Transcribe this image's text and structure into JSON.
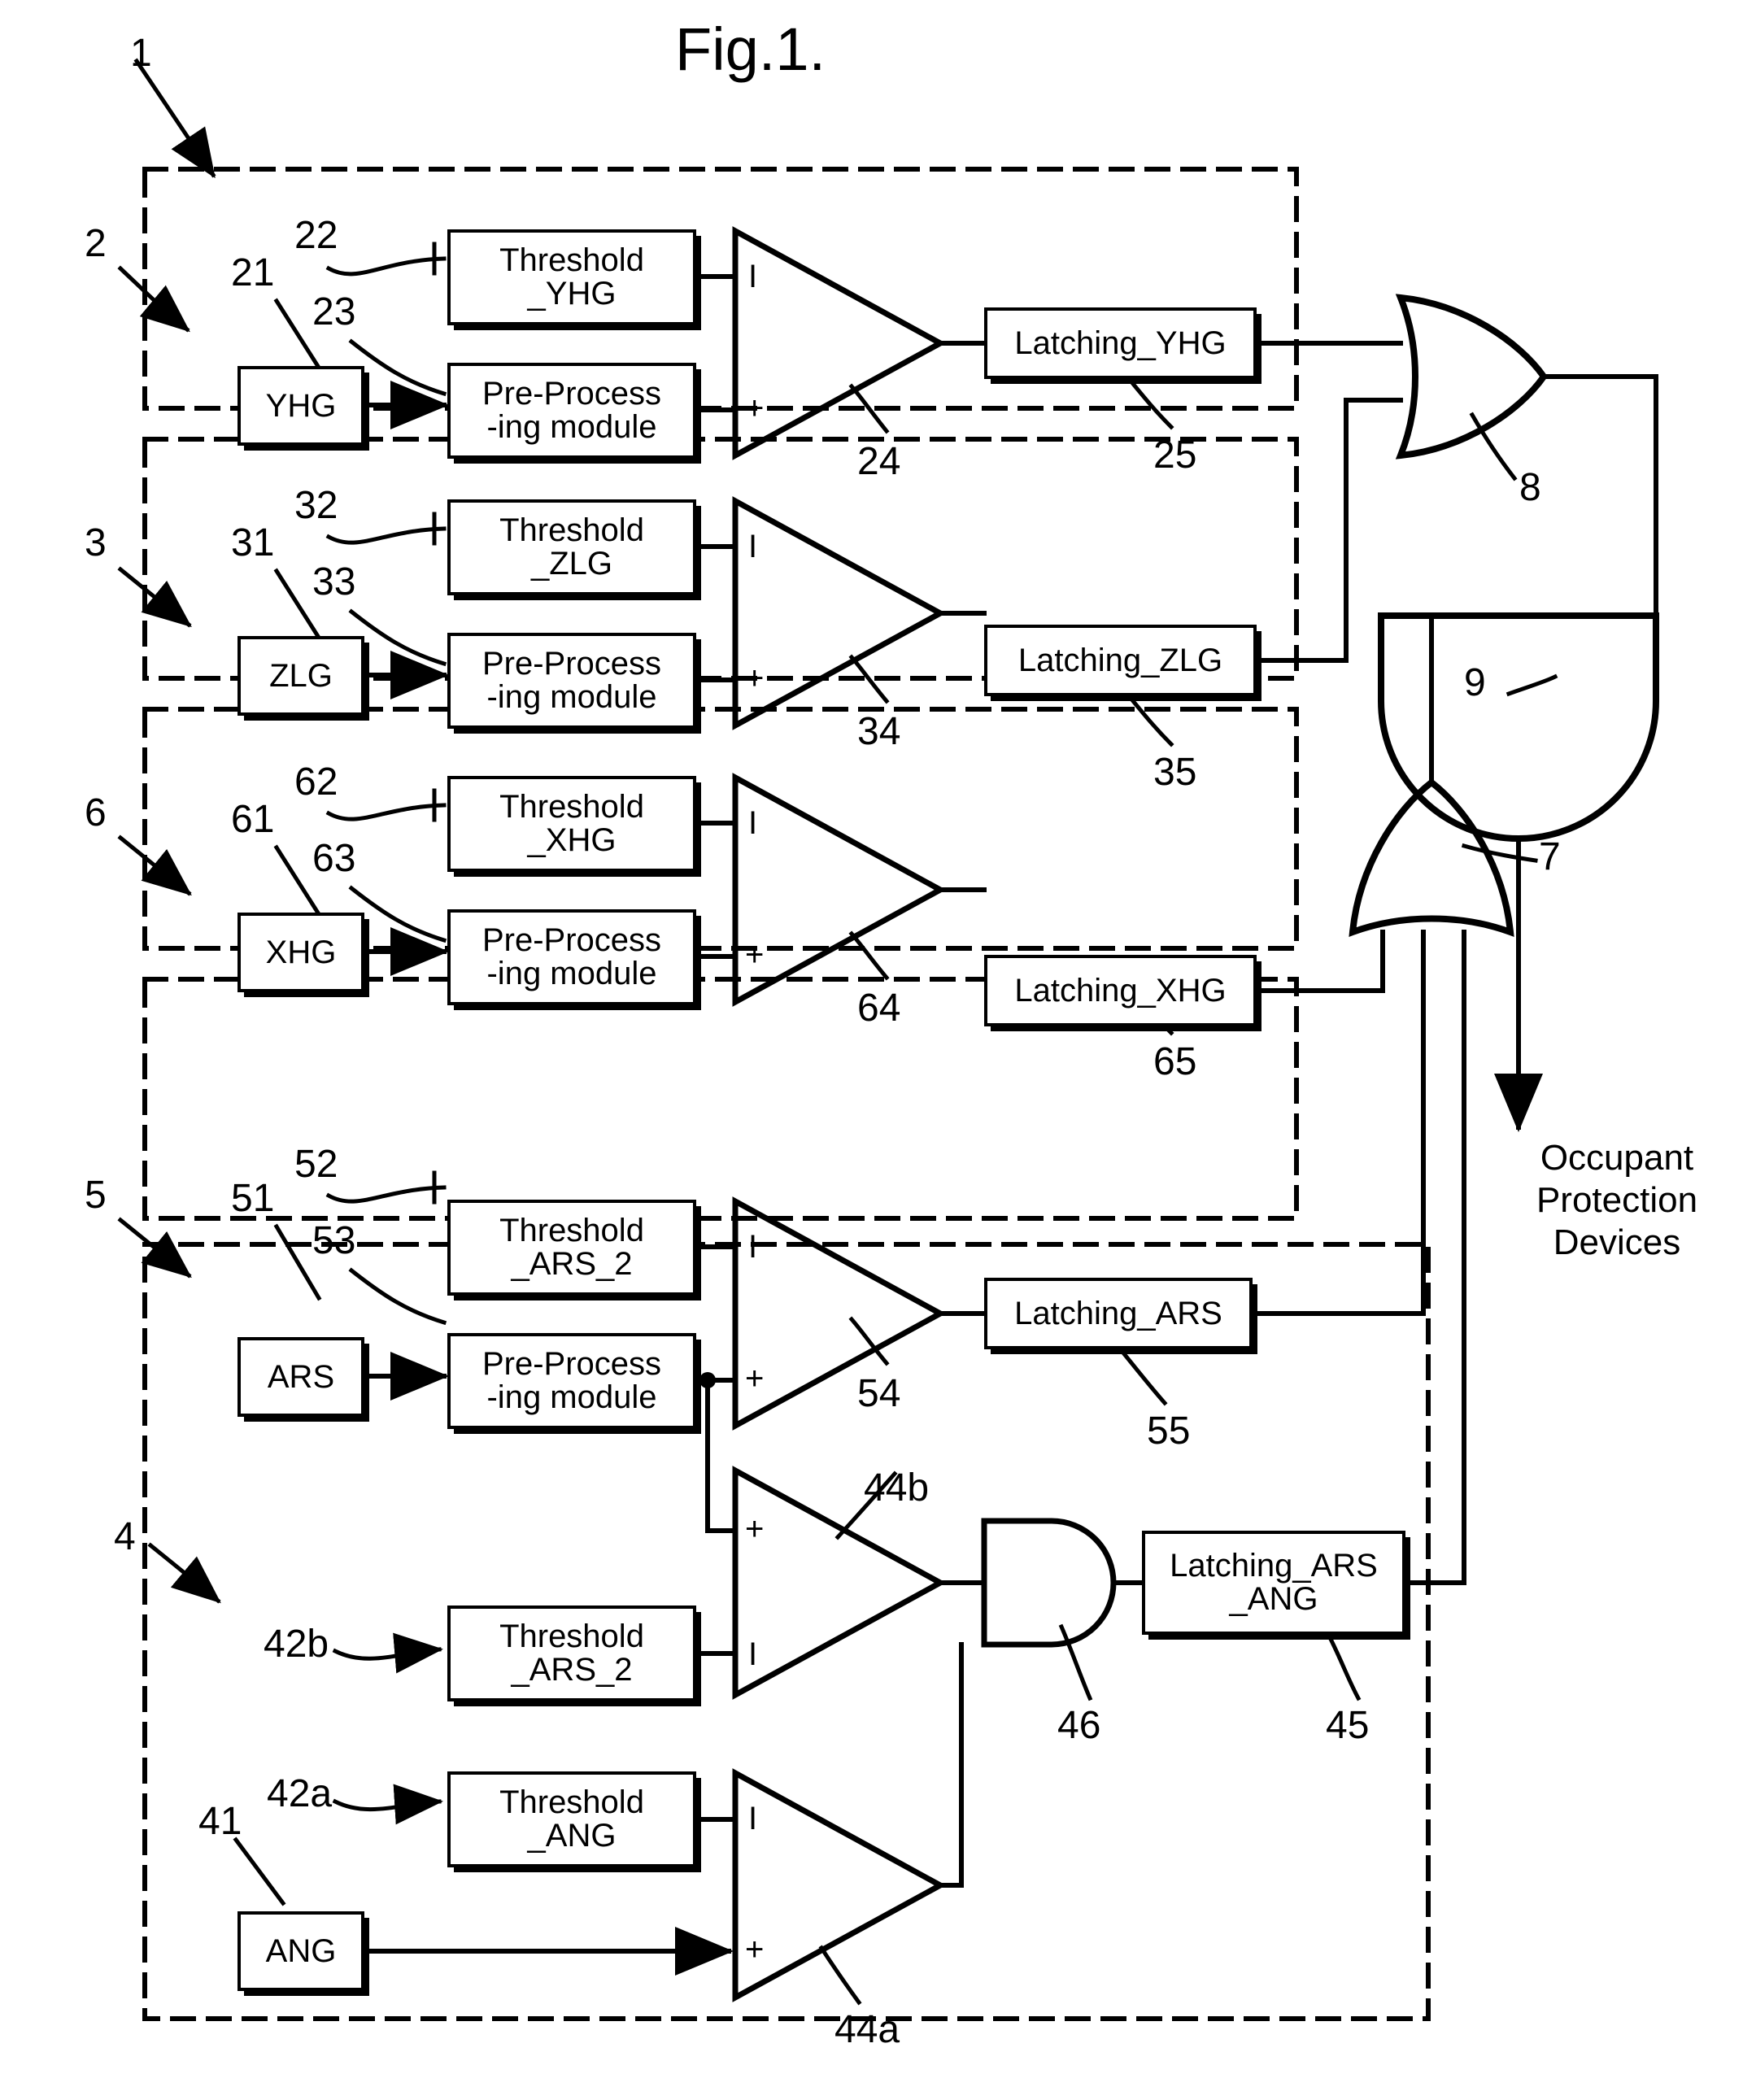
{
  "figure": {
    "title": "Fig.1."
  },
  "output_label": {
    "line1": "Occupant",
    "line2": "Protection",
    "line3": "Devices"
  },
  "channels": [
    {
      "id": "yhg",
      "group_ref": "2",
      "sensor": {
        "ref": "21",
        "label": "YHG"
      },
      "threshold": {
        "ref": "22",
        "line1": "Threshold",
        "line2": "_YHG"
      },
      "preproc": {
        "ref": "23",
        "line1": "Pre-Process",
        "line2": "-ing module"
      },
      "comparator": {
        "ref": "24",
        "minus": "I",
        "plus": "+"
      },
      "latching": {
        "ref": "25",
        "label": "Latching_YHG"
      }
    },
    {
      "id": "zlg",
      "group_ref": "3",
      "sensor": {
        "ref": "31",
        "label": "ZLG"
      },
      "threshold": {
        "ref": "32",
        "line1": "Threshold",
        "line2": "_ZLG"
      },
      "preproc": {
        "ref": "33",
        "line1": "Pre-Process",
        "line2": "-ing module"
      },
      "comparator": {
        "ref": "34",
        "minus": "I",
        "plus": "+"
      },
      "latching": {
        "ref": "35",
        "label": "Latching_ZLG"
      }
    },
    {
      "id": "xhg",
      "group_ref": "6",
      "sensor": {
        "ref": "61",
        "label": "XHG"
      },
      "threshold": {
        "ref": "62",
        "line1": "Threshold",
        "line2": "_XHG"
      },
      "preproc": {
        "ref": "63",
        "line1": "Pre-Process",
        "line2": "-ing module"
      },
      "comparator": {
        "ref": "64",
        "minus": "I",
        "plus": "+"
      },
      "latching": {
        "ref": "65",
        "label": "Latching_XHG"
      }
    },
    {
      "id": "ars",
      "group_ref": "5",
      "sensor": {
        "ref": "51",
        "label": "ARS"
      },
      "threshold": {
        "ref": "52",
        "line1": "Threshold",
        "line2": "_ARS_2"
      },
      "preproc": {
        "ref": "53",
        "line1": "Pre-Process",
        "line2": "-ing module"
      },
      "comparator": {
        "ref": "54",
        "minus": "I",
        "plus": "+"
      },
      "latching": {
        "ref": "55",
        "label": "Latching_ARS"
      }
    }
  ],
  "ang_block": {
    "group_ref": "4",
    "sensor": {
      "ref": "41",
      "label": "ANG"
    },
    "threshold_ang": {
      "ref": "42a",
      "line1": "Threshold",
      "line2": "_ANG"
    },
    "threshold_ars2": {
      "ref": "42b",
      "line1": "Threshold",
      "line2": "_ARS_2"
    },
    "comparator_a": {
      "ref": "44a",
      "minus": "I",
      "plus": "+"
    },
    "comparator_b": {
      "ref": "44b",
      "minus": "I",
      "plus": "+"
    },
    "and_gate": {
      "ref": "46"
    },
    "latching": {
      "ref": "45",
      "line1": "Latching_ARS",
      "line2": "_ANG"
    }
  },
  "system": {
    "ref": "1",
    "or_gate_top": {
      "ref": "8"
    },
    "or_gate_mid": {
      "ref": "7"
    },
    "and_gate_out": {
      "ref": "9"
    }
  },
  "colors": {
    "ink": "#000000",
    "paper": "#ffffff"
  }
}
